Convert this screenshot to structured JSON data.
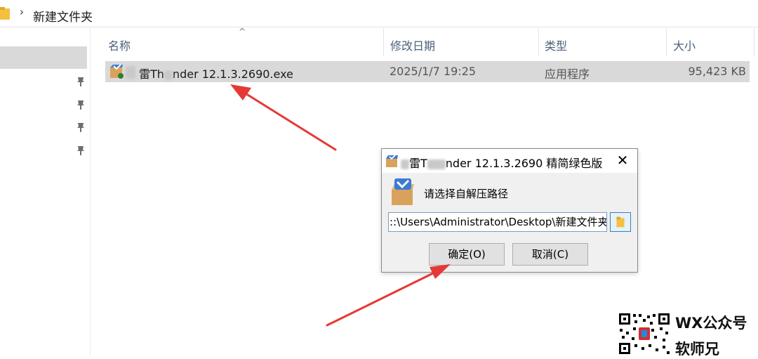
{
  "breadcrumb": {
    "current_folder": "新建文件夹"
  },
  "columns": {
    "name": "名称",
    "modified": "修改日期",
    "type": "类型",
    "size": "大小"
  },
  "file": {
    "name": "迅雷Thunder 12.1.3.2690.exe",
    "name_part1": "雷Th",
    "name_part2": "nder 12.1.3.2690.exe",
    "modified": "2025/1/7 19:25",
    "type": "应用程序",
    "size": "95,423 KB"
  },
  "dialog": {
    "title_part1": "雷T",
    "title_part2": "nder 12.1.3.2690 精简绿色版",
    "close_glyph": "✕",
    "prompt": "请选择自解压路径",
    "path_value": "::\\Users\\Administrator\\Desktop\\新建文件夹",
    "ok_label": "确定(O)",
    "cancel_label": "取消(C)"
  },
  "watermark": {
    "line1": "WX公众号",
    "line2": "软师兄"
  },
  "colors": {
    "selection": "#d9d9d9",
    "header_text": "#4c607a",
    "arrow": "#e53935",
    "folder": "#f4c042"
  },
  "icons": [
    "folder-icon",
    "chevron-right-icon",
    "pin-icon",
    "exe-icon",
    "close-icon",
    "package-icon",
    "browse-folder-icon",
    "qr-code-icon"
  ]
}
